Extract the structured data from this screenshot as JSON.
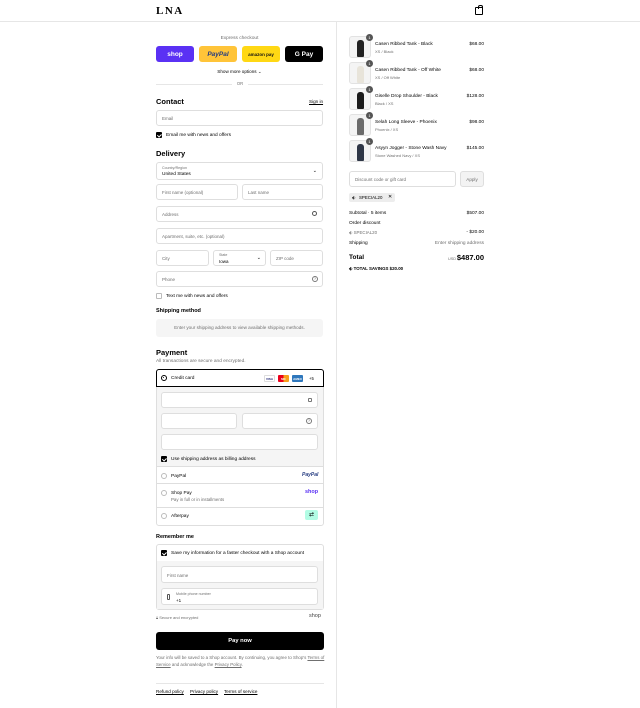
{
  "header": {
    "logo": "LNA"
  },
  "express": {
    "title": "Express checkout",
    "buttons": [
      "shop",
      "PayPal",
      "amazon pay",
      "G Pay"
    ],
    "show_more": "Show more options",
    "or": "OR"
  },
  "contact": {
    "title": "Contact",
    "sign_in": "Sign in",
    "email_placeholder": "Email",
    "news_label": "Email me with news and offers"
  },
  "delivery": {
    "title": "Delivery",
    "country_label": "Country/Region",
    "country_value": "United States",
    "first_name": "First name (optional)",
    "last_name": "Last name",
    "address": "Address",
    "apartment": "Apartment, suite, etc. (optional)",
    "city": "City",
    "state_label": "State",
    "state_value": "Iowa",
    "zip": "ZIP code",
    "phone": "Phone",
    "text_label": "Text me with news and offers"
  },
  "shipping": {
    "title": "Shipping method",
    "notice": "Enter your shipping address to view available shipping methods."
  },
  "payment": {
    "title": "Payment",
    "subtitle": "All transactions are secure and encrypted.",
    "credit_card": "Credit card",
    "card_brands": [
      "VISA",
      "MC",
      "AMEX"
    ],
    "more_brands": "+5",
    "billing_label": "Use shipping address as billing address",
    "paypal": "PayPal",
    "paypal_logo": "PayPal",
    "shop_pay": "Shop Pay",
    "shop_pay_sub": "Pay in full or in installments",
    "shop_logo": "shop",
    "afterpay": "Afterpay"
  },
  "remember": {
    "title": "Remember me",
    "save_label": "Save my information for a faster checkout with a Shop account",
    "first_name": "First name",
    "mobile_label": "Mobile phone number",
    "mobile_value": "+1",
    "secure": "Secure and encrypted",
    "shop_logo": "shop"
  },
  "pay_now": "Pay now",
  "legal": {
    "text1": "Your info will be saved to a Shop account. By continuing, you agree to Shop's",
    "terms": "Terms of Service",
    "and": "and acknowledge the",
    "privacy": "Privacy Policy",
    "end": "."
  },
  "footer": [
    "Refund policy",
    "Privacy policy",
    "Terms of service"
  ],
  "summary": {
    "items": [
      {
        "qty": "1",
        "name": "Casen Ribbed Tank - Black",
        "variant": "XS / Black",
        "price": "$68.00",
        "color": "#222222"
      },
      {
        "qty": "1",
        "name": "Casen Ribbed Tank - Off White",
        "variant": "XS / Off White",
        "price": "$68.00",
        "color": "#e8e4da"
      },
      {
        "qty": "1",
        "name": "Giselle Drop Shoulder - Black",
        "variant": "Black / XS",
        "price": "$128.00",
        "color": "#1a1a1a"
      },
      {
        "qty": "1",
        "name": "Selah Long Sleeve - Phoenix",
        "variant": "Phoenix / XS",
        "price": "$98.00",
        "color": "#6b6b6b"
      },
      {
        "qty": "1",
        "name": "Asyyn Jogger - Stone Wash Navy",
        "variant": "Stone Washed Navy / XS",
        "price": "$145.00",
        "color": "#2e3646"
      }
    ],
    "discount_placeholder": "Discount code or gift card",
    "apply": "Apply",
    "code_tag": "SPECIAL20",
    "subtotal_label": "Subtotal · 5 items",
    "subtotal_value": "$507.00",
    "order_discount": "Order discount",
    "discount_code": "SPECIAL20",
    "discount_value": "- $20.00",
    "shipping_label": "Shipping",
    "shipping_value": "Enter shipping address",
    "total_label": "Total",
    "currency": "USD",
    "total_value": "$487.00",
    "savings_label": "TOTAL SAVINGS",
    "savings_value": "$20.00"
  }
}
